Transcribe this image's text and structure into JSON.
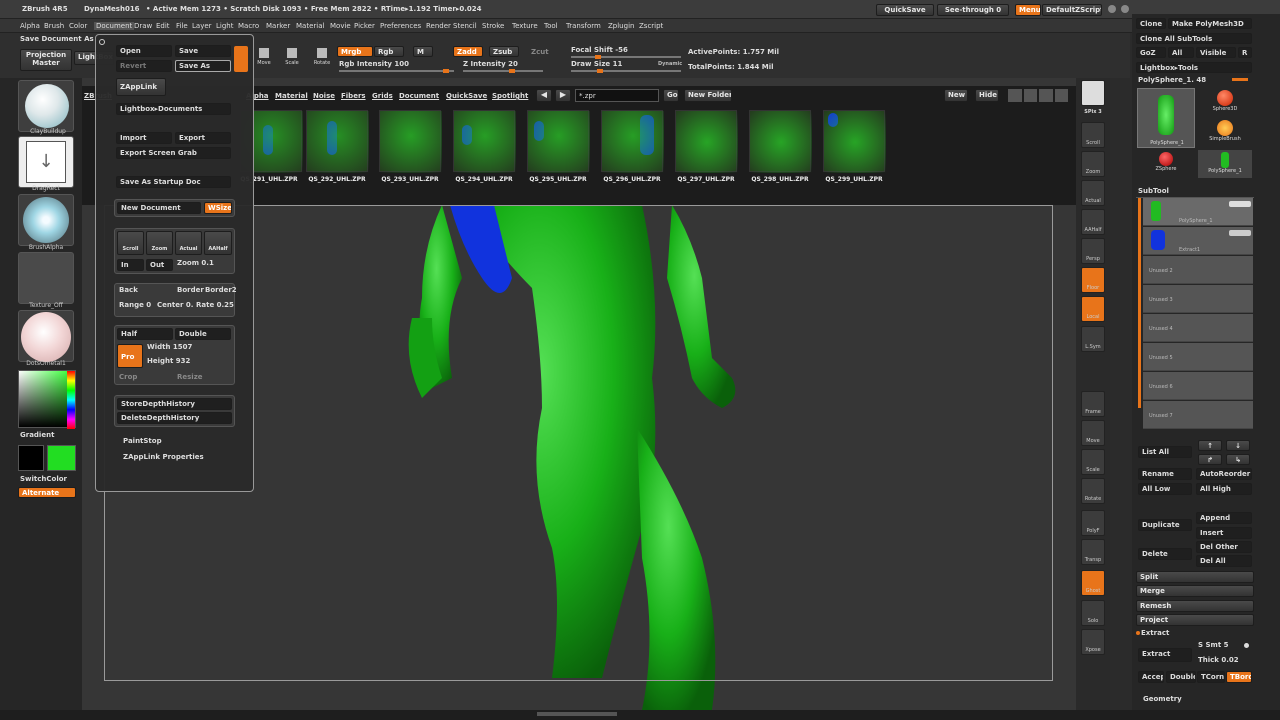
{
  "titlebar": {
    "app": "ZBrush 4R5",
    "mesh": "DynaMesh016",
    "stats": "• Active Mem 1273 • Scratch Disk 1093 • Free Mem 2822 • RTime▸1.192 Timer▸0.024",
    "quicksave": "QuickSave",
    "seethrough": "See-through  0",
    "menus": "Menus",
    "script": "DefaultZScript"
  },
  "menubar": [
    "Alpha",
    "Brush",
    "Color",
    "Document",
    "Draw",
    "Edit",
    "File",
    "Layer",
    "Light",
    "Macro",
    "Marker",
    "Material",
    "Movie",
    "Picker",
    "Preferences",
    "Render",
    "Stencil",
    "Stroke",
    "Texture",
    "Tool",
    "Transform",
    "Zplugin",
    "Zscript"
  ],
  "toolbar": {
    "save_document": "Save Document  As",
    "projection_master": "Projection Master",
    "lightbox": "LightBox",
    "move": "Move",
    "scale": "Scale",
    "rotate": "Rotate",
    "mrgb": "Mrgb",
    "rgb": "Rgb",
    "m": "M",
    "zadd": "Zadd",
    "zsub": "Zsub",
    "zcut": "Zcut",
    "rgb_intensity": "Rgb Intensity 100",
    "z_intensity": "Z Intensity 20",
    "focal_shift": "Focal Shift -56",
    "draw_size": "Draw Size 11",
    "dynamic": "Dynamic",
    "active_points": "ActivePoints: 1.757  Mil",
    "total_points": "TotalPoints: 1.844  Mil"
  },
  "leftshelf": {
    "brush": "ClayBuildup",
    "stroke": "DragRect",
    "alpha": "BrushAlpha",
    "texture": "Texture_Off",
    "material": "DotsOmetal1",
    "gradient": "Gradient",
    "switchcolor": "SwitchColor",
    "alternate": "Alternate"
  },
  "lightbox": {
    "tabs": [
      "ZBrush",
      "Alpha",
      "Material",
      "Noise",
      "Fibers",
      "Grids",
      "Document",
      "QuickSave",
      "Spotlight"
    ],
    "search": "*.zpr",
    "go": "Go",
    "new_folder": "New Folder",
    "new": "New",
    "hide": "Hide",
    "thumbs": [
      "QS_291_UHL.ZPR",
      "QS_292_UHL.ZPR",
      "QS_293_UHL.ZPR",
      "QS_294_UHL.ZPR",
      "QS_295_UHL.ZPR",
      "QS_296_UHL.ZPR",
      "QS_297_UHL.ZPR",
      "QS_298_UHL.ZPR",
      "QS_299_UHL.ZPR"
    ]
  },
  "filemenu": {
    "open": "Open",
    "save": "Save",
    "revert": "Revert",
    "save_as": "Save As",
    "zapplink": "ZAppLink",
    "lightbox_documents": "Lightbox▸Documents",
    "import": "Import",
    "export": "Export",
    "export_screen_grab": "Export Screen Grab",
    "save_startup": "Save As Startup Doc",
    "new_document": "New Document",
    "wsize": "WSize",
    "scroll": "Scroll",
    "zoom": "Zoom",
    "actual": "Actual",
    "aahalf": "AAHalf",
    "in": "In",
    "out": "Out",
    "zoom_value": "Zoom 0.1",
    "back": "Back",
    "border": "Border",
    "border2": "Border2",
    "range": "Range 0",
    "center": "Center 0.",
    "rate": "Rate 0.25",
    "half": "Half",
    "double": "Double",
    "pro": "Pro",
    "width": "Width 1507",
    "height": "Height 932",
    "crop": "Crop",
    "resize": "Resize",
    "store_depth": "StoreDepthHistory",
    "delete_depth": "DeleteDepthHistory",
    "paintstop": "PaintStop",
    "zapplink_props": "ZAppLink Properties"
  },
  "rightshelf": [
    "SPix 3",
    "Scroll",
    "Zoom",
    "Actual",
    "AAHalf",
    "Persp",
    "Floor",
    "Local",
    "L.Sym",
    "Frame",
    "Move",
    "Scale",
    "Rotate",
    "PolyF",
    "Transp",
    "Ghost",
    "Solo",
    "Xpose"
  ],
  "toolpanel": {
    "clone": "Clone",
    "make_polymesh": "Make PolyMesh3D",
    "clone_all": "Clone All SubTools",
    "goz": "GoZ",
    "all": "All",
    "visible": "Visible",
    "r": "R",
    "lightbox_tools": "Lightbox▸Tools",
    "current_tool": "PolySphere_1. 48",
    "tool_polysphere": "PolySphere_1",
    "tool_sphere3d": "Sphere3D",
    "tool_simplebrush": "SimpleBrush",
    "tool_zsphere": "ZSphere",
    "tool_polysphere2": "PolySphere_1",
    "subtool": "SubTool",
    "layers": [
      "PolySphere_1",
      "Extract1",
      "Unused 2",
      "Unused 3",
      "Unused 4",
      "Unused 5",
      "Unused 6",
      "Unused 7"
    ],
    "list_all": "List All",
    "rename": "Rename",
    "autoreorder": "AutoReorder",
    "all_low": "All Low",
    "all_high": "All High",
    "duplicate": "Duplicate",
    "append": "Append",
    "insert": "Insert",
    "delete": "Delete",
    "del_other": "Del Other",
    "del_all": "Del All",
    "split": "Split",
    "merge": "Merge",
    "remesh": "Remesh",
    "project": "Project",
    "extract_header": "Extract",
    "extract_btn": "Extract",
    "smt": "S Smt 5",
    "thick": "Thick 0.02",
    "accept": "Accept",
    "double": "Double",
    "tcorner": "TCorne",
    "tborder": "TBord",
    "geometry": "Geometry"
  },
  "colors": {
    "accent": "#e8741a",
    "model_green": "#1fb81f",
    "model_blue": "#1133dd",
    "primary_color": "#22dd22"
  }
}
